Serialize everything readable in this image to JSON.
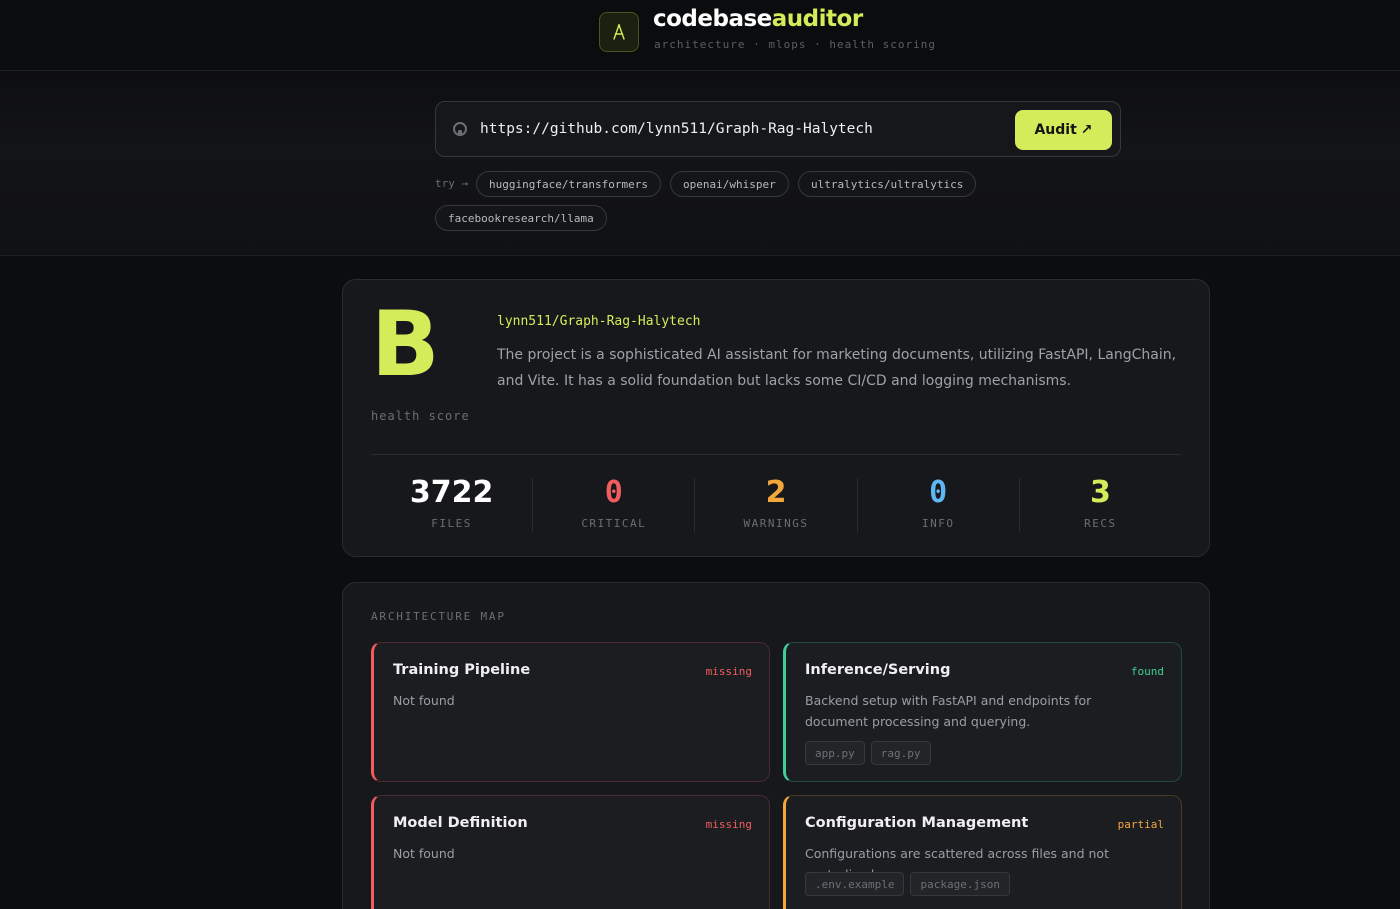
{
  "header": {
    "brand_primary": "codebase",
    "brand_accent": "auditor",
    "tagline": "architecture · mlops · health scoring"
  },
  "search": {
    "value": "https://github.com/lynn511/Graph-Rag-Halytech",
    "button_label": "Audit",
    "button_icon": "↗",
    "try_label": "try →",
    "suggestions": [
      "huggingface/transformers",
      "openai/whisper",
      "ultralytics/ultralytics",
      "facebookresearch/llama"
    ]
  },
  "score": {
    "grade": "B",
    "grade_label": "health score",
    "repo": "lynn511/Graph-Rag-Halytech",
    "summary": "The project is a sophisticated AI assistant for marketing documents, utilizing FastAPI, LangChain, and Vite. It has a solid foundation but lacks some CI/CD and logging mechanisms.",
    "stats": [
      {
        "value": "3722",
        "label": "FILES",
        "color": "#ffffff"
      },
      {
        "value": "0",
        "label": "CRITICAL",
        "color": "#ef5d5d"
      },
      {
        "value": "2",
        "label": "WARNINGS",
        "color": "#f3a63b"
      },
      {
        "value": "0",
        "label": "INFO",
        "color": "#5fb6f5"
      },
      {
        "value": "3",
        "label": "RECS",
        "color": "#d4ec5a"
      }
    ]
  },
  "architecture": {
    "title": "ARCHITECTURE MAP",
    "panels": [
      {
        "title": "Training Pipeline",
        "status": "missing",
        "description": "Not found",
        "files": []
      },
      {
        "title": "Inference/Serving",
        "status": "found",
        "description": "Backend setup with FastAPI and endpoints for document processing and querying.",
        "files": [
          "app.py",
          "rag.py"
        ]
      },
      {
        "title": "Model Definition",
        "status": "missing",
        "description": "Not found",
        "files": []
      },
      {
        "title": "Configuration Management",
        "status": "partial",
        "description": "Configurations are scattered across files and not centralized.",
        "files": [
          ".env.example",
          "package.json"
        ]
      }
    ]
  },
  "colors": {
    "accent": "#d4ec5a",
    "missing": "#ef5d5d",
    "found": "#3fcf95",
    "partial": "#f3a63b"
  }
}
